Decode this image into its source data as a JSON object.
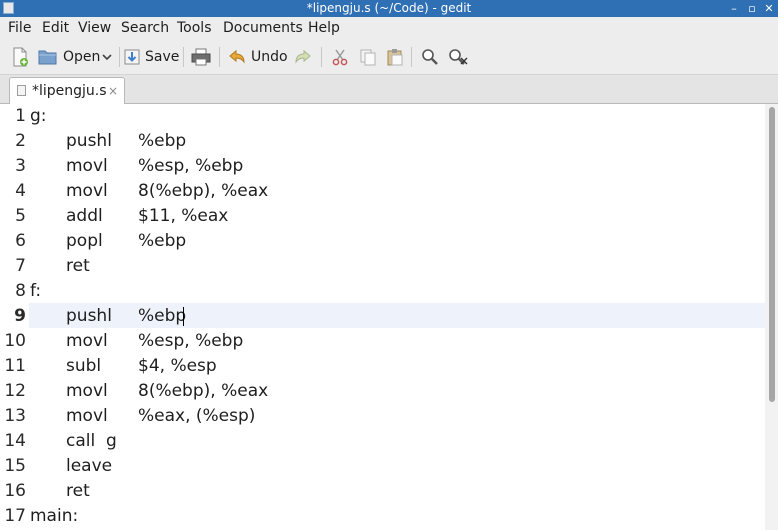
{
  "window": {
    "title": "*lipengju.s (~/Code) - gedit",
    "minimize": "–",
    "maximize": "▫",
    "close": "✕"
  },
  "menu": [
    "File",
    "Edit",
    "View",
    "Search",
    "Tools",
    "Documents",
    "Help"
  ],
  "toolbar": {
    "open_label": "Open",
    "save_label": "Save",
    "undo_label": "Undo"
  },
  "tab": {
    "label": "*lipengju.s",
    "close": "×"
  },
  "editor": {
    "current_line": 9,
    "lines": [
      {
        "n": "1",
        "label": "g:"
      },
      {
        "n": "2",
        "op": "pushl",
        "arg": "%ebp"
      },
      {
        "n": "3",
        "op": "movl",
        "arg": "%esp, %ebp"
      },
      {
        "n": "4",
        "op": "movl",
        "arg": "8(%ebp), %eax"
      },
      {
        "n": "5",
        "op": "addl",
        "arg": "$11, %eax"
      },
      {
        "n": "6",
        "op": "popl",
        "arg": "%ebp"
      },
      {
        "n": "7",
        "op": "ret"
      },
      {
        "n": "8",
        "label": "f:"
      },
      {
        "n": "9",
        "op": "pushl",
        "arg": "%ebp"
      },
      {
        "n": "10",
        "op": "movl",
        "arg": "%esp, %ebp"
      },
      {
        "n": "11",
        "op": "subl",
        "arg": "$4, %esp"
      },
      {
        "n": "12",
        "op": "movl",
        "arg": "8(%ebp), %eax"
      },
      {
        "n": "13",
        "op": "movl",
        "arg": "%eax, (%esp)"
      },
      {
        "n": "14",
        "op": "call  g"
      },
      {
        "n": "15",
        "op": "leave"
      },
      {
        "n": "16",
        "op": "ret"
      },
      {
        "n": "17",
        "label": "main:"
      }
    ]
  }
}
